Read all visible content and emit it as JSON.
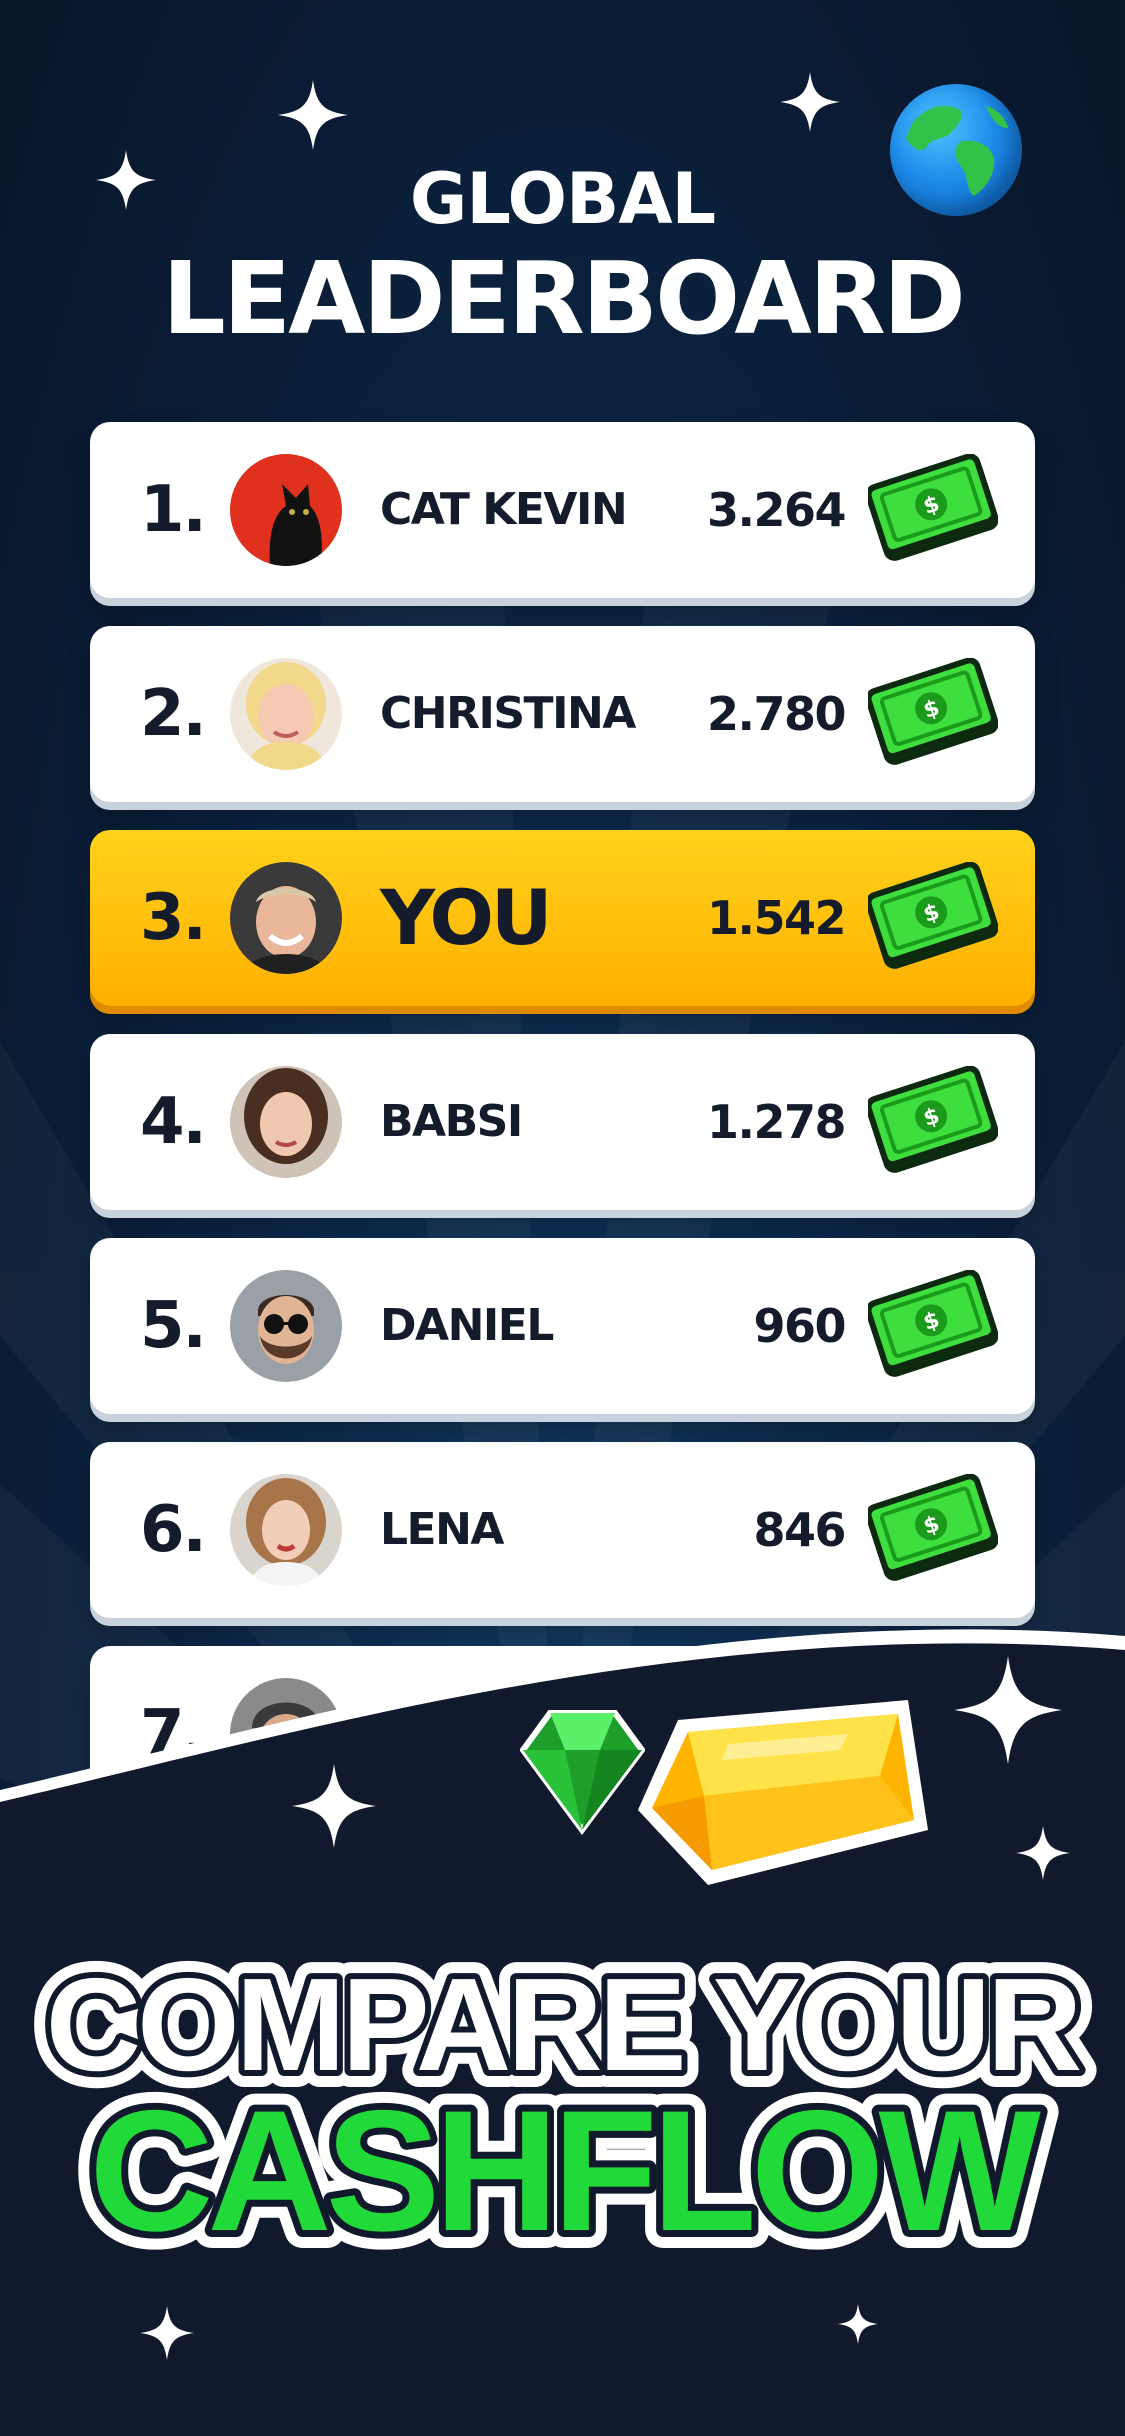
{
  "header": {
    "title_line1": "GLOBAL",
    "title_line2": "LEADERBOARD",
    "globe_icon": "globe-icon"
  },
  "leaderboard": [
    {
      "rank": "1.",
      "name": "CAT KEVIN",
      "score": "3.264",
      "avatar": "cat-avatar",
      "highlight": false
    },
    {
      "rank": "2.",
      "name": "CHRISTINA",
      "score": "2.780",
      "avatar": "blonde-woman-avatar",
      "highlight": false
    },
    {
      "rank": "3.",
      "name": "YOU",
      "score": "1.542",
      "avatar": "smiling-man-avatar",
      "highlight": true
    },
    {
      "rank": "4.",
      "name": "BABSI",
      "score": "1.278",
      "avatar": "woman-avatar",
      "highlight": false
    },
    {
      "rank": "5.",
      "name": "DANIEL",
      "score": "960",
      "avatar": "bearded-man-sunglasses-avatar",
      "highlight": false
    },
    {
      "rank": "6.",
      "name": "LENA",
      "score": "846",
      "avatar": "woman-selfie-avatar",
      "highlight": false
    },
    {
      "rank": "7.",
      "name": "",
      "score": "",
      "avatar": "beanie-avatar",
      "highlight": false
    }
  ],
  "currency_icon": "cash-bill-icon",
  "promo": {
    "line1": "COMPARE YOUR",
    "line2": "CASHFLOW",
    "icons": [
      "emerald-gem-icon",
      "gold-bar-icon",
      "sparkle-icon"
    ]
  },
  "colors": {
    "background": "#0a1d36",
    "highlight_row": "#ffc20e",
    "cash_green": "#2fd12f",
    "slogan_green": "#22d93a",
    "text_dark": "#141c2c"
  }
}
